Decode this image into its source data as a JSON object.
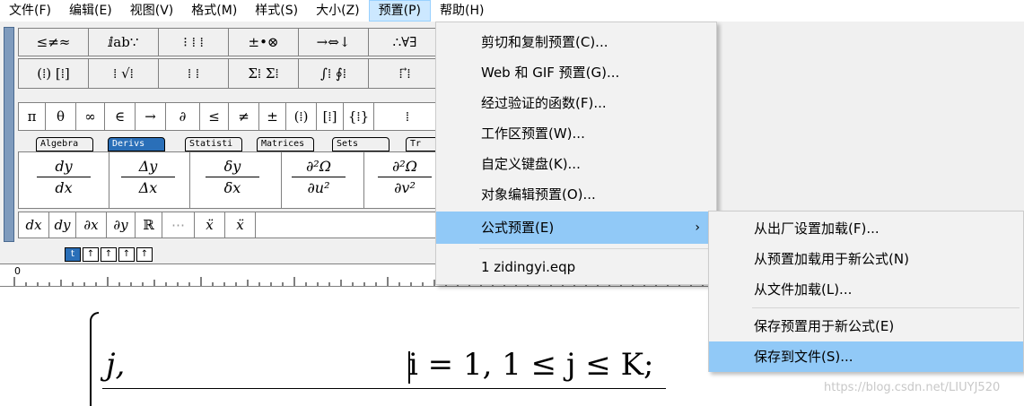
{
  "menubar": {
    "items": [
      {
        "label": "文件(F)"
      },
      {
        "label": "编辑(E)"
      },
      {
        "label": "视图(V)"
      },
      {
        "label": "格式(M)"
      },
      {
        "label": "样式(S)"
      },
      {
        "label": "大小(Z)"
      },
      {
        "label": "预置(P)"
      },
      {
        "label": "帮助(H)"
      }
    ]
  },
  "toolbar": {
    "row1": [
      "≤≠≈",
      "ⅈab∵",
      "⁝ ⁞ ⁞",
      "±•⊗",
      "→⇔↓",
      "∴∀∃"
    ],
    "row2": [
      "(⁞) [⁞]",
      "⁞ √⁞",
      "⁞ ⁞",
      "Σ⁞ Σ⁞",
      "∫⁞ ∮⁞",
      "⁞ ⃗⁞"
    ],
    "row3": [
      "π",
      "θ",
      "∞",
      "∈",
      "→",
      "∂",
      "≤",
      "≠",
      "±",
      "(⁞)",
      "[⁞]",
      "{⁞}",
      "⁞"
    ],
    "tabs": [
      "Algebra",
      "Derivs",
      "Statisti",
      "Matrices",
      "Sets",
      "Tr"
    ],
    "templates": [
      {
        "num": "dy",
        "den": "dx"
      },
      {
        "num": "Δy",
        "den": "Δx"
      },
      {
        "num": "δy",
        "den": "δx"
      },
      {
        "num": "∂²Ω",
        "den": "∂u²"
      },
      {
        "num": "∂²Ω",
        "den": "∂v²"
      }
    ],
    "row4": [
      "dx",
      "dy",
      "∂x",
      "∂y",
      "ℝ",
      "⋯",
      "ẍ",
      "ẍ"
    ],
    "size_buttons": [
      "t",
      "↑",
      "↑",
      "↑",
      "↑"
    ]
  },
  "ruler": {
    "zero_label": "0"
  },
  "editor": {
    "var": "j,",
    "condition": "i = 1,    1 ≤ j ≤ K;"
  },
  "preset_menu": {
    "items": [
      {
        "label": "剪切和复制预置(C)..."
      },
      {
        "label": "Web 和 GIF 预置(G)..."
      },
      {
        "label": "经过验证的函数(F)..."
      },
      {
        "label": "工作区预置(W)..."
      },
      {
        "label": "自定义键盘(K)..."
      },
      {
        "label": "对象编辑预置(O)..."
      },
      {
        "label": "公式预置(E)",
        "arrow": "›"
      },
      {
        "label": "1 zidingyi.eqp"
      }
    ]
  },
  "formula_submenu": {
    "items": [
      {
        "label": "从出厂设置加载(F)..."
      },
      {
        "label": "从预置加载用于新公式(N)"
      },
      {
        "label": "从文件加载(L)..."
      },
      {
        "label": "保存预置用于新公式(E)"
      },
      {
        "label": "保存到文件(S)..."
      }
    ]
  },
  "watermark": "https://blog.csdn.net/LIUYJ520",
  "colors": {
    "highlight": "#91c9f7",
    "menubar_active": "#cce8ff",
    "tab_selected": "#2a6fb8"
  }
}
